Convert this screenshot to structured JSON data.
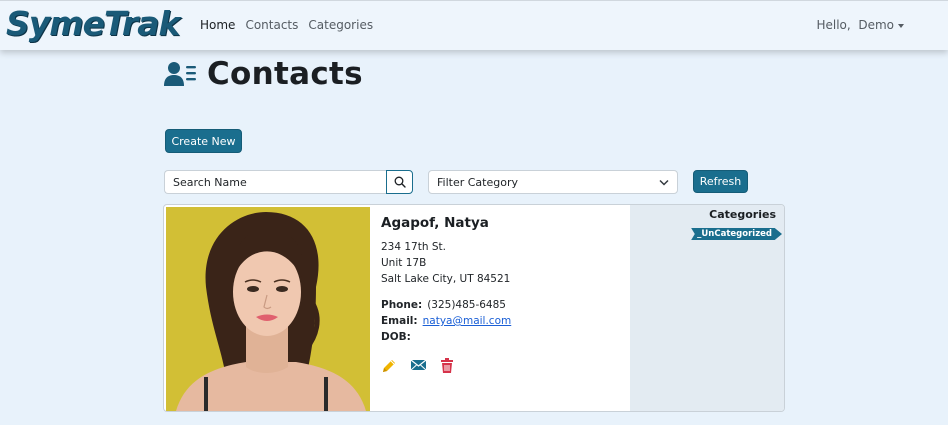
{
  "navbar": {
    "brand": "SymeTrak",
    "links": [
      "Home",
      "Contacts",
      "Categories"
    ],
    "user_greeting": "Hello,  Demo"
  },
  "page": {
    "title": "Contacts",
    "create_label": "Create New",
    "search_placeholder": "Search Name",
    "filter_label": "Filter Category",
    "refresh_label": "Refresh"
  },
  "contact": {
    "name": "Agapof, Natya",
    "address1": "234 17th St.",
    "address2": "Unit 17B",
    "city_line": "Salt Lake City, UT 84521",
    "phone_label": "Phone:",
    "phone": "(325)485-6485",
    "email_label": "Email:",
    "email": "natya@mail.com",
    "dob_label": "DOB:",
    "dob": ""
  },
  "categories": {
    "title": "Categories",
    "items": [
      "_UnCategorized"
    ]
  },
  "colors": {
    "primary": "#1a6e8e",
    "edit": "#f0b400",
    "delete": "#d6334a",
    "background": "#e8f2fb"
  }
}
